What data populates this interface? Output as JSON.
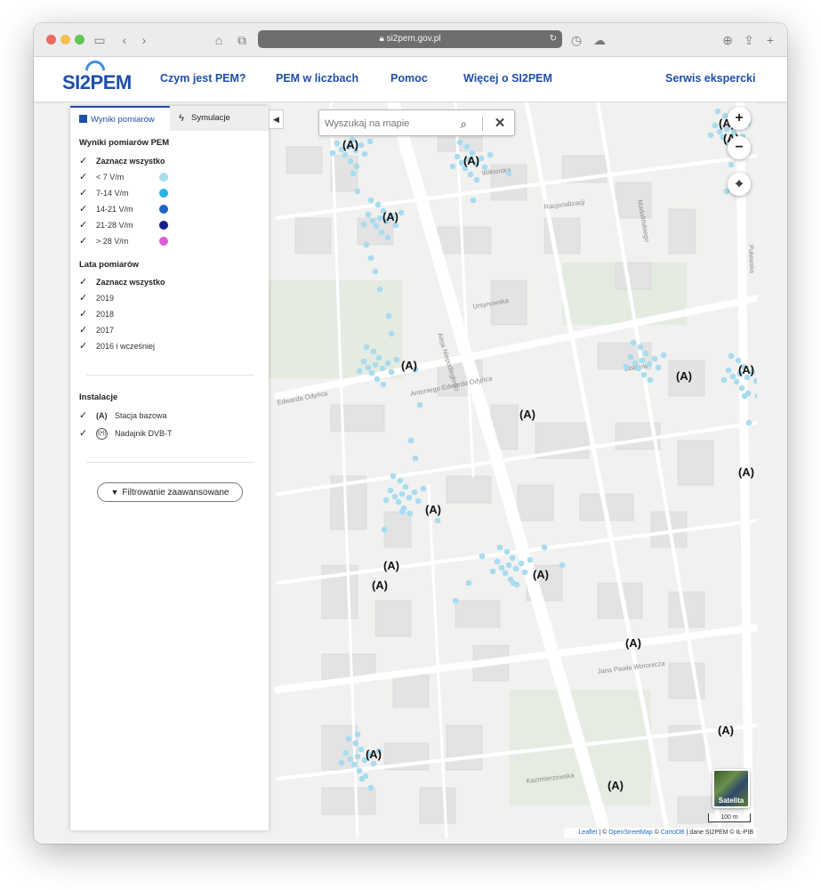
{
  "browser": {
    "url": "si2pem.gov.pl"
  },
  "header": {
    "logo": "SI2PEM",
    "nav": [
      "Czym jest PEM?",
      "PEM w liczbach",
      "Pomoc",
      "Więcej o SI2PEM",
      "Serwis ekspercki"
    ]
  },
  "sidebar": {
    "tabs": {
      "results": "Wyniki pomiarów",
      "simulation": "Symulacje"
    },
    "results_heading": "Wyniki pomiarów PEM",
    "select_all": "Zaznacz wszystko",
    "levels": [
      {
        "label": "< 7 V/m",
        "color": "#a8dcf0"
      },
      {
        "label": "7-14 V/m",
        "color": "#23b5e6"
      },
      {
        "label": "14-21 V/m",
        "color": "#1e63c6"
      },
      {
        "label": "21-28 V/m",
        "color": "#141e8c"
      },
      {
        "label": "> 28 V/m",
        "color": "#e05bd4"
      }
    ],
    "years_heading": "Lata pomiarów",
    "years_select_all": "Zaznacz wszystko",
    "years": [
      "2019",
      "2018",
      "2017",
      "2016 i wcześniej"
    ],
    "installations_heading": "Instalacje",
    "installations": [
      "Stacja bazowa",
      "Nadajnik DVB-T"
    ],
    "filter_button": "Filtrowanie zaawansowane"
  },
  "map": {
    "search_placeholder": "Wyszukaj na mapie",
    "zoom_in": "+",
    "zoom_out": "−",
    "satellite_label": "Satelita",
    "scale_label": "100 m",
    "attribution": {
      "leaflet": "Leaflet",
      "osm": "OpenStreetMap",
      "carto": "CartoDB",
      "rest": "| dane SI2PEM © IŁ-PIB"
    },
    "street_labels": [
      "Aleja Niepodległości",
      "Antoniego Edwarda Odyńca",
      "Puławska",
      "Jana Pawła Woronicza",
      "Edwarda Odyńca",
      "Wiktorska",
      "Racjonalizacji",
      "Madalińskiego",
      "Szarotki",
      "Kazimierzowska",
      "Ursynowska"
    ],
    "station_marker": "(A)",
    "accent_color": "#1f4fa8"
  }
}
